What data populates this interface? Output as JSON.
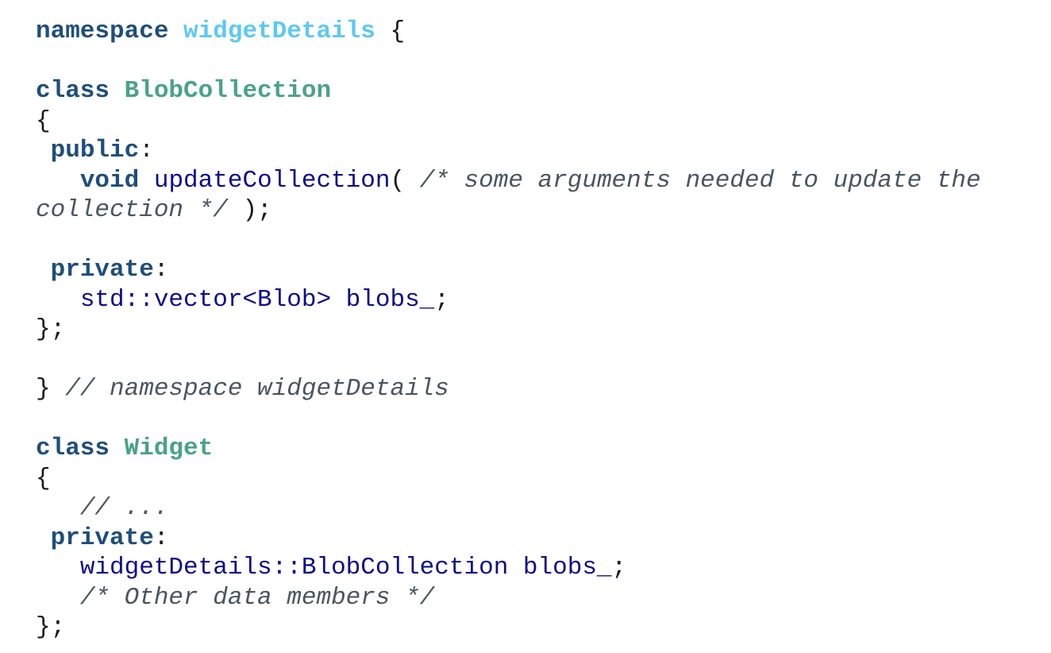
{
  "code": {
    "lines": [
      {
        "tokens": [
          {
            "t": "namespace",
            "c": "kw"
          },
          {
            "t": " ",
            "c": "pn"
          },
          {
            "t": "widgetDetails",
            "c": "ns"
          },
          {
            "t": " {",
            "c": "pn"
          }
        ]
      },
      {
        "tokens": []
      },
      {
        "tokens": [
          {
            "t": "class",
            "c": "kw"
          },
          {
            "t": " ",
            "c": "pn"
          },
          {
            "t": "BlobCollection",
            "c": "ty"
          }
        ]
      },
      {
        "tokens": [
          {
            "t": "{",
            "c": "pn"
          }
        ]
      },
      {
        "tokens": [
          {
            "t": " ",
            "c": "pn"
          },
          {
            "t": "public",
            "c": "kw"
          },
          {
            "t": ":",
            "c": "pn"
          }
        ]
      },
      {
        "tokens": [
          {
            "t": "   ",
            "c": "pn"
          },
          {
            "t": "void",
            "c": "kw"
          },
          {
            "t": " ",
            "c": "pn"
          },
          {
            "t": "updateCollection",
            "c": "id"
          },
          {
            "t": "( ",
            "c": "pn"
          },
          {
            "t": "/* some arguments needed to update the",
            "c": "cm"
          }
        ]
      },
      {
        "tokens": [
          {
            "t": "collection */",
            "c": "cm"
          },
          {
            "t": " );",
            "c": "pn"
          }
        ]
      },
      {
        "tokens": []
      },
      {
        "tokens": [
          {
            "t": " ",
            "c": "pn"
          },
          {
            "t": "private",
            "c": "kw"
          },
          {
            "t": ":",
            "c": "pn"
          }
        ]
      },
      {
        "tokens": [
          {
            "t": "   ",
            "c": "pn"
          },
          {
            "t": "std::vector<Blob> blobs_",
            "c": "id"
          },
          {
            "t": ";",
            "c": "pn"
          }
        ]
      },
      {
        "tokens": [
          {
            "t": "};",
            "c": "pn"
          }
        ]
      },
      {
        "tokens": []
      },
      {
        "tokens": [
          {
            "t": "} ",
            "c": "pn"
          },
          {
            "t": "// namespace widgetDetails",
            "c": "cm"
          }
        ]
      },
      {
        "tokens": []
      },
      {
        "tokens": [
          {
            "t": "class",
            "c": "kw"
          },
          {
            "t": " ",
            "c": "pn"
          },
          {
            "t": "Widget",
            "c": "ty"
          }
        ]
      },
      {
        "tokens": [
          {
            "t": "{",
            "c": "pn"
          }
        ]
      },
      {
        "tokens": [
          {
            "t": "   ",
            "c": "pn"
          },
          {
            "t": "// ...",
            "c": "cm"
          }
        ]
      },
      {
        "tokens": [
          {
            "t": " ",
            "c": "pn"
          },
          {
            "t": "private",
            "c": "kw"
          },
          {
            "t": ":",
            "c": "pn"
          }
        ]
      },
      {
        "tokens": [
          {
            "t": "   ",
            "c": "pn"
          },
          {
            "t": "widgetDetails::BlobCollection blobs_",
            "c": "id"
          },
          {
            "t": ";",
            "c": "pn"
          }
        ]
      },
      {
        "tokens": [
          {
            "t": "   ",
            "c": "pn"
          },
          {
            "t": "/* Other data members */",
            "c": "cm"
          }
        ]
      },
      {
        "tokens": [
          {
            "t": "};",
            "c": "pn"
          }
        ]
      }
    ]
  },
  "colors": {
    "keyword": "#1f4e7a",
    "namespace_name": "#5ec8f2",
    "type_name": "#4aa384",
    "identifier": "#0d0d8a",
    "comment": "#4a5560",
    "punctuation": "#1a1a1a",
    "background": "#ffffff"
  }
}
